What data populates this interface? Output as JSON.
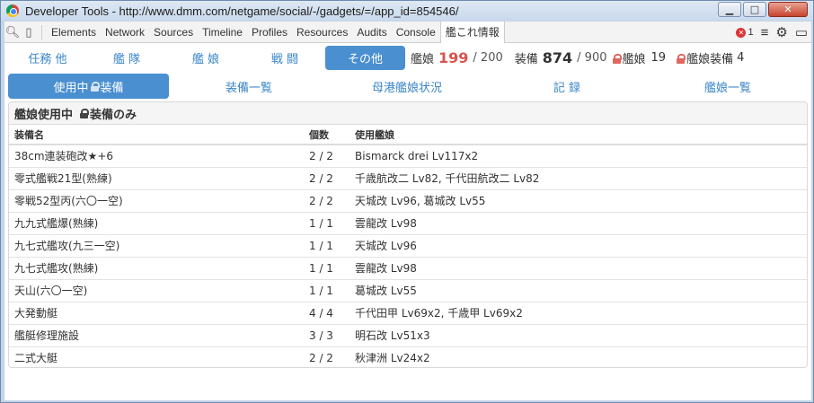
{
  "window": {
    "title": "Developer Tools - http://www.dmm.com/netgame/social/-/gadgets/=/app_id=854546/",
    "btn_minimize": "▁",
    "btn_maximize": "□",
    "btn_close": "✕"
  },
  "devtools": {
    "tabs": [
      "Elements",
      "Network",
      "Sources",
      "Timeline",
      "Profiles",
      "Resources",
      "Audits",
      "Console",
      "艦これ情報"
    ],
    "error_count": "1"
  },
  "main_tabs": [
    "任務 他",
    "艦 隊",
    "艦 娘",
    "戦 闘",
    "その他"
  ],
  "stats": {
    "ship_label": "艦娘",
    "ship_count": "199",
    "ship_max": "/ 200",
    "equip_label": "装備",
    "equip_count": "874",
    "equip_max": "/ 900",
    "locked_ship_label": "艦娘",
    "locked_ship_count": "19",
    "locked_equip_label": "艦娘装備",
    "locked_equip_count": "4"
  },
  "sub_tabs": {
    "active_left": "使用中",
    "active_right": "装備",
    "items": [
      "装備一覧",
      "母港艦娘状況",
      "記 録",
      "艦娘一覧"
    ]
  },
  "panel": {
    "heading_left": "艦娘使用中",
    "heading_right": "装備のみ",
    "columns": [
      "装備名",
      "個数",
      "使用艦娘"
    ],
    "rows": [
      {
        "name": "38cm連装砲改★+6",
        "count": "2 / 2",
        "ships": "Bismarck drei Lv117x2"
      },
      {
        "name": "零式艦戦21型(熟練)",
        "count": "2 / 2",
        "ships": "千歳航改二 Lv82, 千代田航改二 Lv82"
      },
      {
        "name": "零戦52型丙(六〇一空)",
        "count": "2 / 2",
        "ships": "天城改 Lv96, 葛城改 Lv55"
      },
      {
        "name": "九九式艦爆(熟練)",
        "count": "1 / 1",
        "ships": "雲龍改 Lv98"
      },
      {
        "name": "九七式艦攻(九三一空)",
        "count": "1 / 1",
        "ships": "天城改 Lv96"
      },
      {
        "name": "九七式艦攻(熟練)",
        "count": "1 / 1",
        "ships": "雲龍改 Lv98"
      },
      {
        "name": "天山(六〇一空)",
        "count": "1 / 1",
        "ships": "葛城改 Lv55"
      },
      {
        "name": "大発動艇",
        "count": "4 / 4",
        "ships": "千代田甲 Lv69x2, 千歳甲 Lv69x2"
      },
      {
        "name": "艦艇修理施設",
        "count": "3 / 3",
        "ships": "明石改 Lv51x3"
      },
      {
        "name": "二式大艇",
        "count": "2 / 2",
        "ships": "秋津洲 Lv24x2"
      }
    ]
  }
}
